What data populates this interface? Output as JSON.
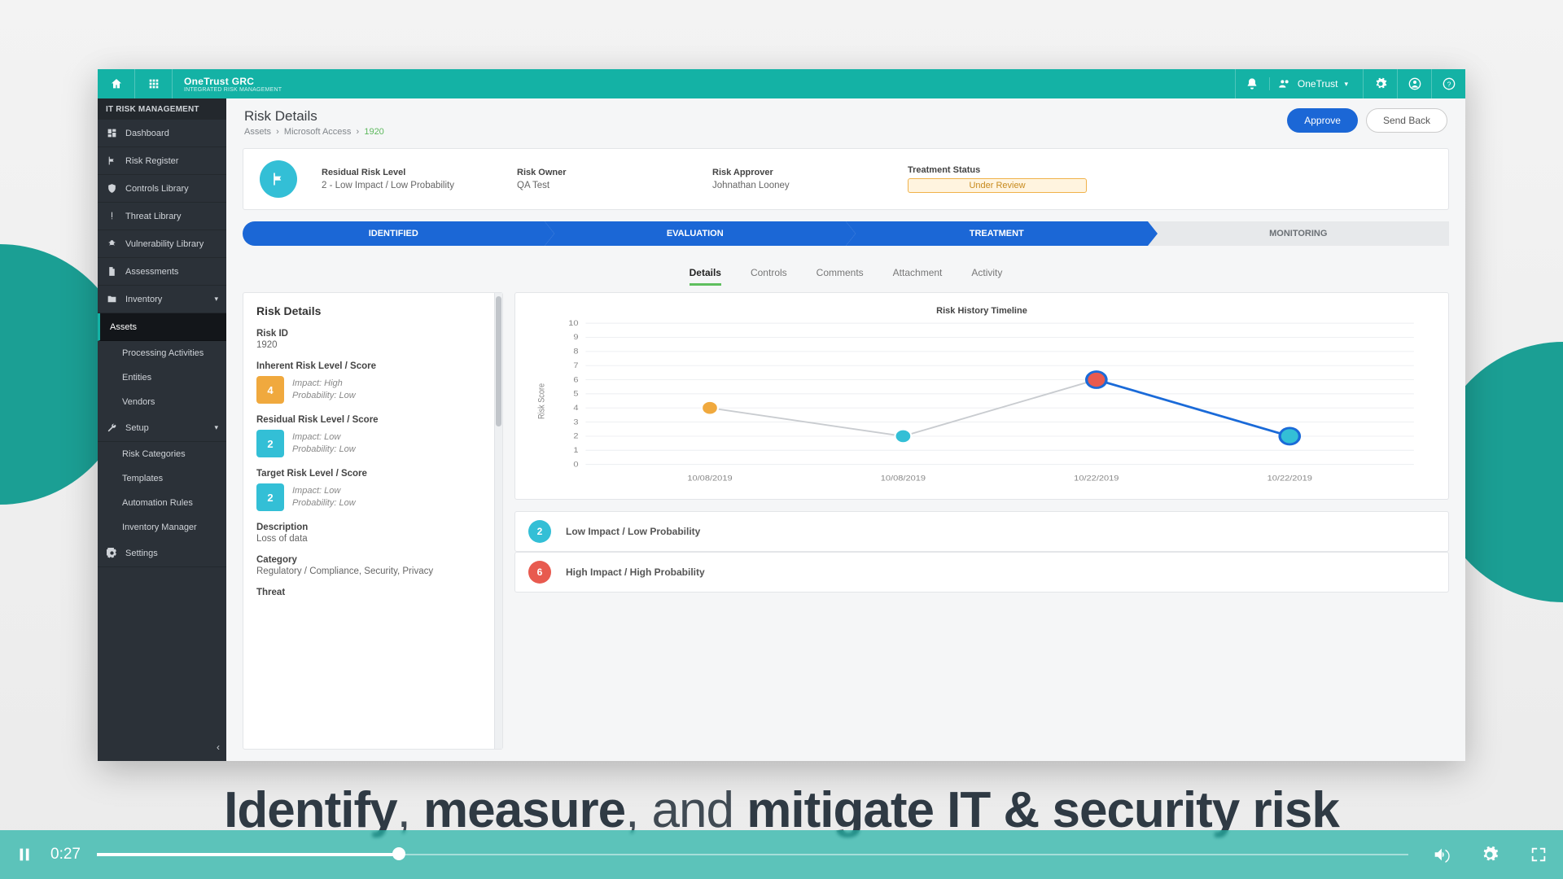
{
  "topbar": {
    "brand": "OneTrust GRC",
    "brand_sub": "INTEGRATED RISK MANAGEMENT",
    "tenant": "OneTrust"
  },
  "sidebar": {
    "title": "IT RISK MANAGEMENT",
    "items": [
      {
        "label": "Dashboard",
        "icon": "dashboard"
      },
      {
        "label": "Risk Register",
        "icon": "flag"
      },
      {
        "label": "Controls Library",
        "icon": "shield"
      },
      {
        "label": "Threat Library",
        "icon": "alert"
      },
      {
        "label": "Vulnerability Library",
        "icon": "bug"
      },
      {
        "label": "Assessments",
        "icon": "doc"
      }
    ],
    "inventory_label": "Inventory",
    "inventory_children": [
      {
        "label": "Assets",
        "selected": true
      },
      {
        "label": "Processing Activities"
      },
      {
        "label": "Entities"
      },
      {
        "label": "Vendors"
      }
    ],
    "setup_label": "Setup",
    "setup_children": [
      {
        "label": "Risk Categories"
      },
      {
        "label": "Templates"
      },
      {
        "label": "Automation Rules"
      },
      {
        "label": "Inventory Manager"
      }
    ],
    "settings_label": "Settings"
  },
  "page": {
    "title": "Risk Details",
    "crumb": [
      "Assets",
      "Microsoft Access"
    ],
    "crumb_current": "1920",
    "approve": "Approve",
    "sendback": "Send Back"
  },
  "summary": {
    "residual_lbl": "Residual Risk Level",
    "residual_val": "2 - Low Impact / Low Probability",
    "owner_lbl": "Risk Owner",
    "owner_val": "QA Test",
    "approver_lbl": "Risk Approver",
    "approver_val": "Johnathan Looney",
    "treat_lbl": "Treatment Status",
    "treat_val": "Under Review"
  },
  "stages": [
    "IDENTIFIED",
    "EVALUATION",
    "TREATMENT",
    "MONITORING"
  ],
  "active_stage_index": 2,
  "tabs": [
    "Details",
    "Controls",
    "Comments",
    "Attachment",
    "Activity"
  ],
  "active_tab_index": 0,
  "details": {
    "hdr": "Risk Details",
    "riskid_lbl": "Risk ID",
    "riskid_val": "1920",
    "inherent_lbl": "Inherent Risk Level / Score",
    "inherent_score": "4",
    "inherent_impact": "Impact: High",
    "inherent_prob": "Probability: Low",
    "residual_lbl": "Residual Risk Level / Score",
    "residual_score": "2",
    "residual_impact": "Impact: Low",
    "residual_prob": "Probability: Low",
    "target_lbl": "Target Risk Level / Score",
    "target_score": "2",
    "target_impact": "Impact: Low",
    "target_prob": "Probability: Low",
    "desc_lbl": "Description",
    "desc_val": "Loss of data",
    "cat_lbl": "Category",
    "cat_val": "Regulatory / Compliance, Security, Privacy",
    "threat_lbl": "Threat"
  },
  "chart_data": {
    "type": "line",
    "title": "Risk History Timeline",
    "ylabel": "Risk Score",
    "xlabel": "",
    "ylim": [
      0,
      10
    ],
    "yticks": [
      0,
      1,
      2,
      3,
      4,
      5,
      6,
      7,
      8,
      9,
      10
    ],
    "categories": [
      "10/08/2019",
      "10/08/2019",
      "10/22/2019",
      "10/22/2019"
    ],
    "series": [
      {
        "name": "history",
        "values": [
          4,
          2,
          6,
          2
        ],
        "point_color": [
          "#f0a93e",
          "#33bfd6",
          "#e85a4f",
          "#33bfd6"
        ]
      }
    ],
    "blue_segment": {
      "from_index": 2,
      "to_index": 3
    }
  },
  "legend": [
    {
      "score": "2",
      "label": "Low Impact / Low Probability",
      "cls": "blue"
    },
    {
      "score": "6",
      "label": "High Impact / High Probability",
      "cls": "red"
    }
  ],
  "tagline_html": "<b>Identify</b>, <b>measure</b>, and <b>mitigate IT &amp; security risk</b>",
  "player": {
    "time": "0:27",
    "progress_pct": 23
  }
}
